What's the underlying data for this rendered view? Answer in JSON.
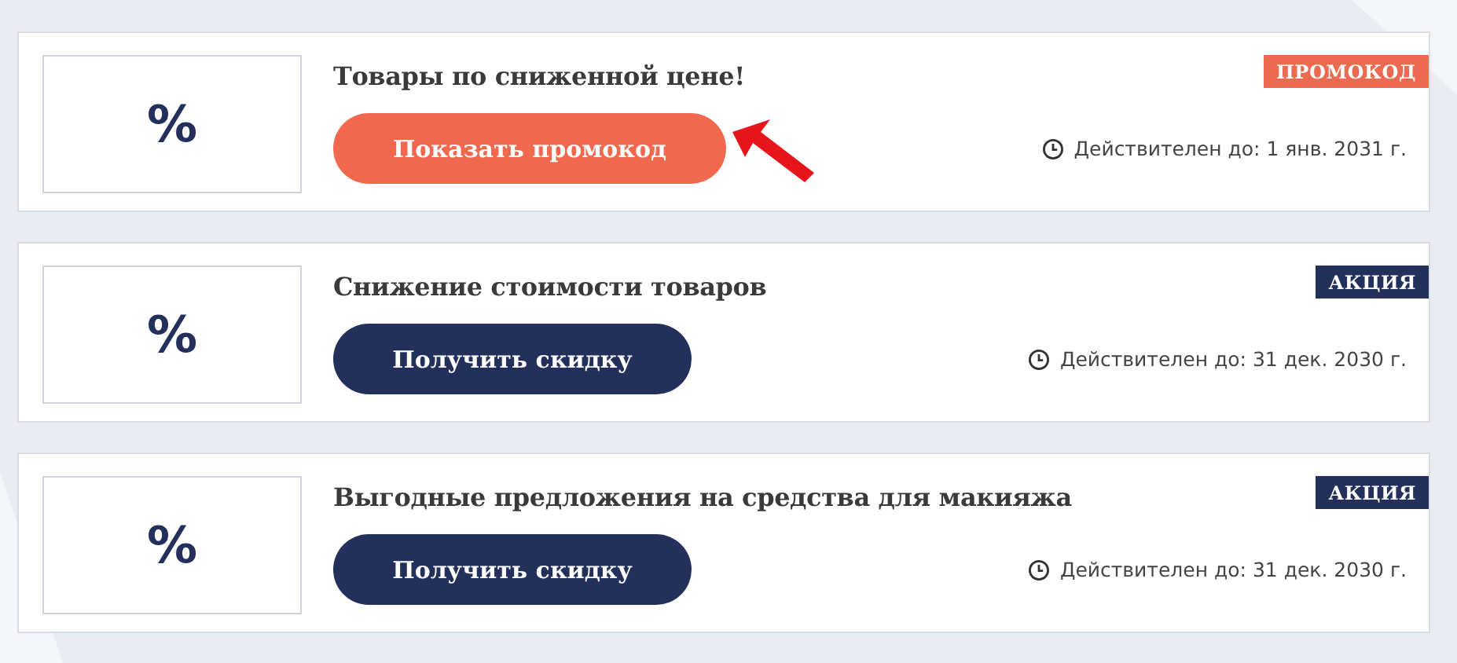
{
  "offers": [
    {
      "logo": "%",
      "title": "Товары по сниженной цене!",
      "button": "Показать промокод",
      "kind": "promocode",
      "badge": "ПРОМОКОД",
      "validity": "Действителен до: 1 янв. 2031 г.",
      "pointer_arrow": true
    },
    {
      "logo": "%",
      "title": "Снижение стоимости товаров",
      "button": "Получить скидку",
      "kind": "deal",
      "badge": "АКЦИЯ",
      "validity": "Действителен до: 31 дек. 2030 г.",
      "pointer_arrow": false
    },
    {
      "logo": "%",
      "title": "Выгодные предложения на средства для макияжа",
      "button": "Получить скидку",
      "kind": "deal",
      "badge": "АКЦИЯ",
      "validity": "Действителен до: 31 дек. 2030 г.",
      "pointer_arrow": false
    }
  ]
}
